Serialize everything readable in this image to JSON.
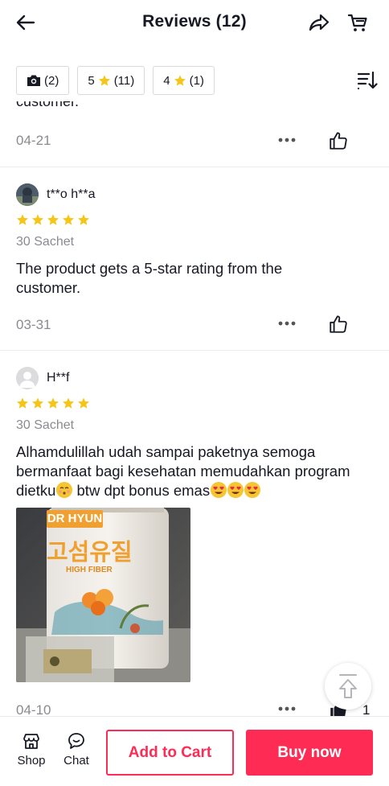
{
  "header": {
    "title": "Reviews (12)",
    "back_icon": "arrow-left-icon",
    "share_icon": "share-icon",
    "cart_icon": "cart-icon"
  },
  "filters": [
    {
      "icon": "camera-icon",
      "label": "(2)"
    },
    {
      "value": "5",
      "icon": "star-icon",
      "label": "(11)"
    },
    {
      "value": "4",
      "icon": "star-icon",
      "label": "(1)"
    }
  ],
  "sort_icon": "sort-icon",
  "partial_review": {
    "text_tail": "customer.",
    "date": "04-21"
  },
  "reviews": [
    {
      "username": "t**o h**a",
      "rating": 5,
      "variant": "30 Sachet",
      "text": "The product gets a 5-star rating from the customer.",
      "date": "03-31"
    },
    {
      "username": "H**f",
      "rating": 5,
      "variant": "30 Sachet",
      "text_line1": "Alhamdulillah udah sampai paketnya semoga",
      "text_line2": "bermanfaat bagi kesehatan memudahkan program",
      "text_line3a": "dietku",
      "text_line3b": " btw dpt bonus emas",
      "photo": {
        "brand": "DR HYUN",
        "korean": "고섬유질",
        "sub": "HIGH FIBER"
      },
      "date": "04-10",
      "likes": "1"
    }
  ],
  "colors": {
    "accent": "#fe2c55",
    "star": "#f5c518",
    "muted": "#8a8b91"
  },
  "bottom_bar": {
    "shop_label": "Shop",
    "chat_label": "Chat",
    "add_to_cart": "Add to Cart",
    "buy_now": "Buy now"
  }
}
